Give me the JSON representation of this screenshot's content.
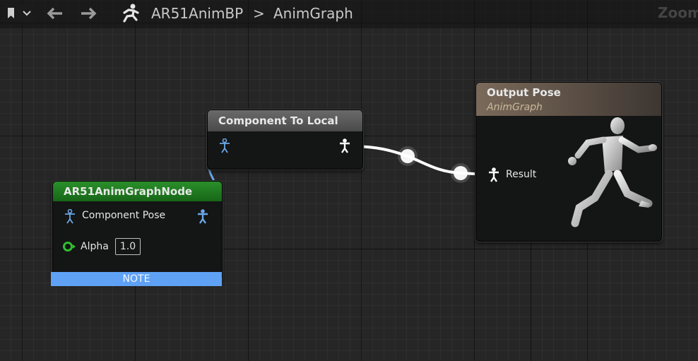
{
  "toolbar": {
    "bookmark_icon": "bookmark-icon",
    "back_icon": "arrow-left-icon",
    "forward_icon": "arrow-right-icon",
    "breadcrumb": {
      "blueprint": "AR51AnimBP",
      "separator": ">",
      "graph": "AnimGraph"
    },
    "zoom_label": "Zoom"
  },
  "nodes": {
    "anim_graph_node": {
      "title": "AR51AnimGraphNode",
      "title_color": "#1f7a1f",
      "pins": {
        "component_pose": "Component Pose",
        "alpha": "Alpha",
        "alpha_value": "1.0"
      },
      "note": "NOTE"
    },
    "component_to_local": {
      "title": "Component To Local"
    },
    "output_pose": {
      "title": "Output Pose",
      "subtitle": "AnimGraph",
      "pins": {
        "result": "Result"
      }
    }
  },
  "colors": {
    "pose_pin": "#6aa8e8",
    "exec_wire": "#ffffff",
    "note_bar": "#5fa2f5",
    "alpha_pin": "#2fbf2f"
  }
}
